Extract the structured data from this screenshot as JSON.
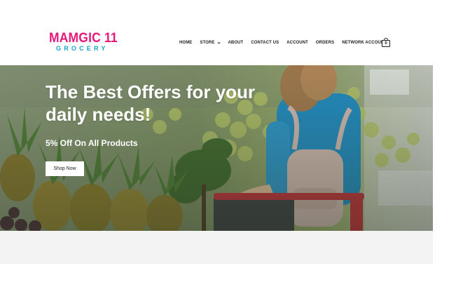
{
  "header": {
    "logo": {
      "main": "MAMGIC 11",
      "sub": "GROCERY"
    },
    "nav": [
      {
        "label": "Home",
        "has_dropdown": false
      },
      {
        "label": "Store",
        "has_dropdown": true
      },
      {
        "label": "About",
        "has_dropdown": false
      },
      {
        "label": "Contact Us",
        "has_dropdown": false
      },
      {
        "label": "Account",
        "has_dropdown": false
      },
      {
        "label": "Orders",
        "has_dropdown": false
      },
      {
        "label": "Network Account",
        "has_dropdown": false
      }
    ],
    "cart": {
      "icon": "shopping-bag-icon",
      "count": "0"
    }
  },
  "hero": {
    "title": "The Best Offers for your daily needs!",
    "subtitle": "5% Off On All Products",
    "button_label": "Shop Now"
  },
  "colors": {
    "brand_pink": "#e6197b",
    "brand_blue": "#18a3c9",
    "band_gray": "#f3f3f3"
  }
}
